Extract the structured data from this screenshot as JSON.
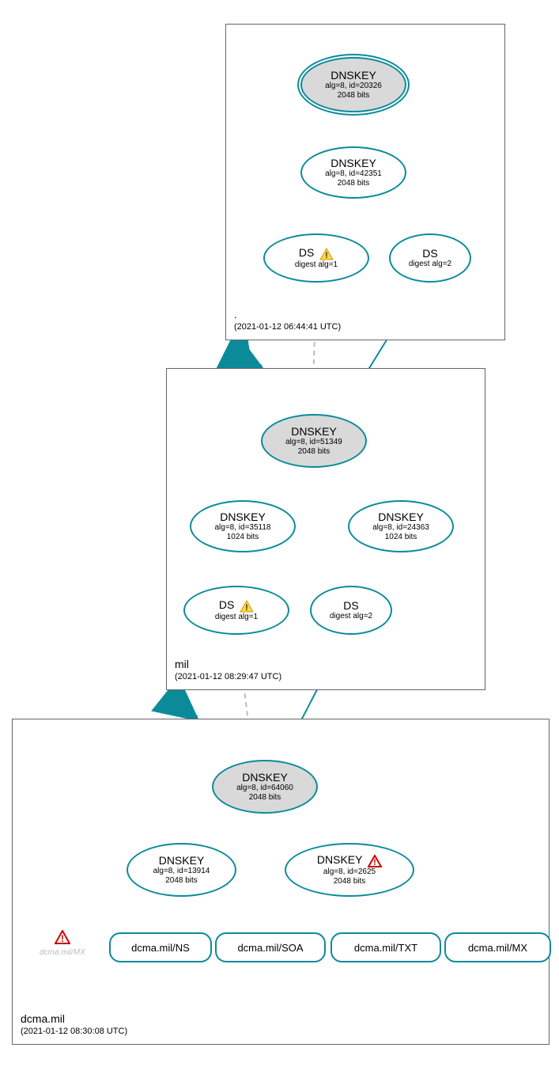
{
  "zones": {
    "root": {
      "label": ".",
      "timestamp": "(2021-01-12 06:44:41 UTC)"
    },
    "mil": {
      "label": "mil",
      "timestamp": "(2021-01-12 08:29:47 UTC)"
    },
    "dcma": {
      "label": "dcma.mil",
      "timestamp": "(2021-01-12 08:30:08 UTC)"
    }
  },
  "nodes": {
    "root_ksk": {
      "title": "DNSKEY",
      "line2": "alg=8, id=20326",
      "line3": "2048 bits"
    },
    "root_zsk": {
      "title": "DNSKEY",
      "line2": "alg=8, id=42351",
      "line3": "2048 bits"
    },
    "root_ds1": {
      "title": "DS",
      "line2": "digest alg=1"
    },
    "root_ds2": {
      "title": "DS",
      "line2": "digest alg=2"
    },
    "mil_ksk": {
      "title": "DNSKEY",
      "line2": "alg=8, id=51349",
      "line3": "2048 bits"
    },
    "mil_zsk1": {
      "title": "DNSKEY",
      "line2": "alg=8, id=35118",
      "line3": "1024 bits"
    },
    "mil_zsk2": {
      "title": "DNSKEY",
      "line2": "alg=8, id=24363",
      "line3": "1024 bits"
    },
    "mil_ds1": {
      "title": "DS",
      "line2": "digest alg=1"
    },
    "mil_ds2": {
      "title": "DS",
      "line2": "digest alg=2"
    },
    "dcma_ksk": {
      "title": "DNSKEY",
      "line2": "alg=8, id=64060",
      "line3": "2048 bits"
    },
    "dcma_zsk1": {
      "title": "DNSKEY",
      "line2": "alg=8, id=13914",
      "line3": "2048 bits"
    },
    "dcma_zsk2": {
      "title": "DNSKEY",
      "line2": "alg=8, id=2625",
      "line3": "2048 bits"
    }
  },
  "rr": {
    "ns": "dcma.mil/NS",
    "soa": "dcma.mil/SOA",
    "txt": "dcma.mil/TXT",
    "mx": "dcma.mil/MX"
  },
  "ghost": {
    "mx": "dcma.mil/MX"
  }
}
